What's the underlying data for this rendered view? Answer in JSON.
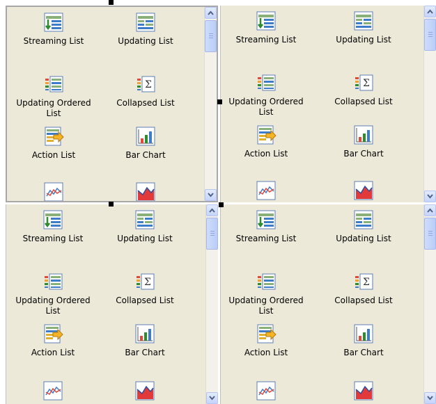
{
  "items": [
    {
      "label": "Streaming List",
      "icon": "streaming-list-icon"
    },
    {
      "label": "Updating List",
      "icon": "updating-list-icon"
    },
    {
      "label": "Updating Ordered List",
      "icon": "updating-ordered-list-icon"
    },
    {
      "label": "Collapsed List",
      "icon": "collapsed-list-icon"
    },
    {
      "label": "Action List",
      "icon": "action-list-icon"
    },
    {
      "label": "Bar Chart",
      "icon": "bar-chart-icon"
    },
    {
      "label": "",
      "icon": "line-chart-icon"
    },
    {
      "label": "",
      "icon": "area-chart-icon"
    }
  ],
  "colors": {
    "panel_bg": "#ece9d8",
    "scroll_button": "#c6d4fb",
    "selected_border": "#a8a8a8"
  }
}
